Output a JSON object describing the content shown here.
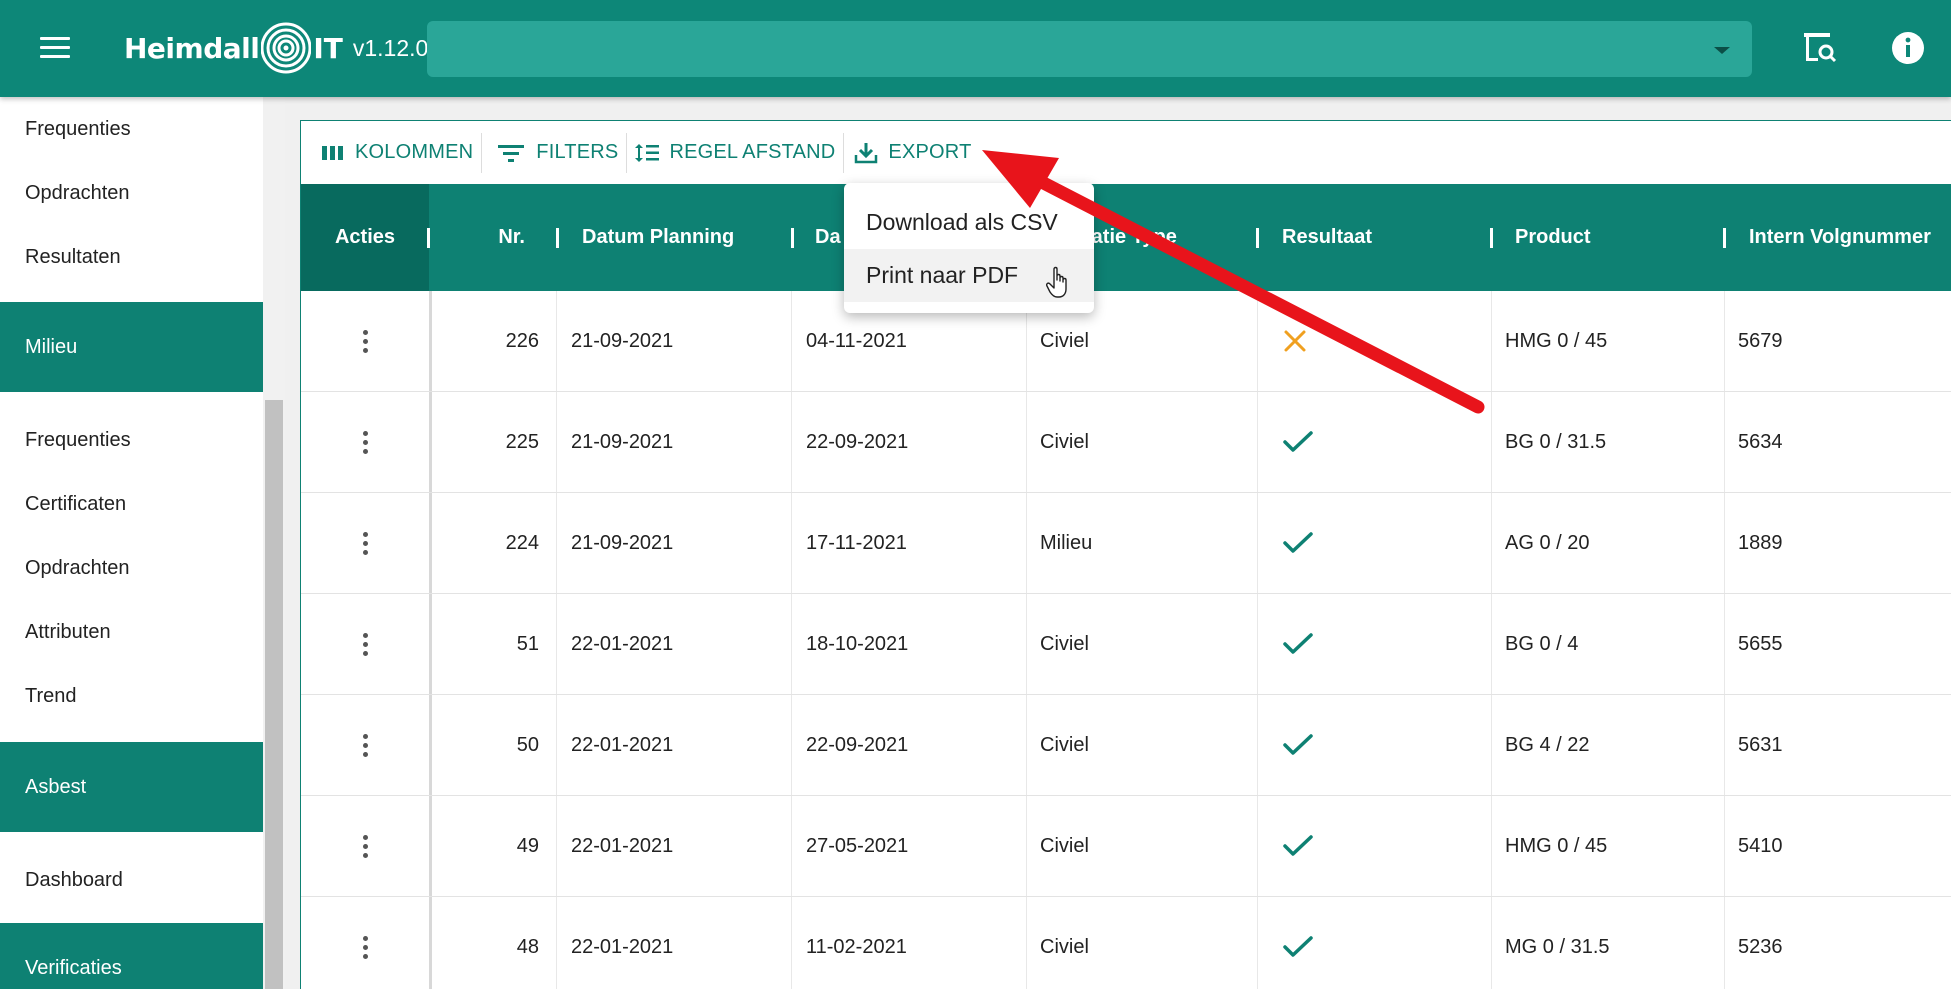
{
  "app": {
    "brand": "Heimdall",
    "brand_suffix": "IT",
    "version": "v1.12.0",
    "top_select_value": "",
    "icons": {
      "menu": "hamburger-icon",
      "search": "search-history-icon",
      "info": "info-icon"
    }
  },
  "sidebar": {
    "items": [
      {
        "label": "Frequenties",
        "type": "item"
      },
      {
        "label": "Opdrachten",
        "type": "item"
      },
      {
        "label": "Resultaten",
        "type": "item"
      },
      {
        "label": "Milieu",
        "type": "section"
      },
      {
        "label": "Frequenties",
        "type": "item"
      },
      {
        "label": "Certificaten",
        "type": "item"
      },
      {
        "label": "Opdrachten",
        "type": "item"
      },
      {
        "label": "Attributen",
        "type": "item"
      },
      {
        "label": "Trend",
        "type": "item"
      },
      {
        "label": "Asbest",
        "type": "section"
      },
      {
        "label": "Dashboard",
        "type": "item"
      },
      {
        "label": "Verificaties",
        "type": "section"
      }
    ]
  },
  "toolbar": {
    "kolommen": "KOLOMMEN",
    "filters": "FILTERS",
    "regel_afstand": "REGEL AFSTAND",
    "export": "EXPORT"
  },
  "export_menu": {
    "items": [
      "Download als CSV",
      "Print naar PDF"
    ]
  },
  "table": {
    "columns": [
      "Acties",
      "Nr.",
      "Datum Planning",
      "Da",
      "icatie Type",
      "Resultaat",
      "Product",
      "Intern Volgnummer"
    ],
    "rows": [
      {
        "nr": "226",
        "datum_planning": "21-09-2021",
        "datum": "04-11-2021",
        "type": "Civiel",
        "resultaat": "fail",
        "product": "HMG 0 / 45",
        "volgnummer": "5679"
      },
      {
        "nr": "225",
        "datum_planning": "21-09-2021",
        "datum": "22-09-2021",
        "type": "Civiel",
        "resultaat": "pass",
        "product": "BG 0 / 31.5",
        "volgnummer": "5634"
      },
      {
        "nr": "224",
        "datum_planning": "21-09-2021",
        "datum": "17-11-2021",
        "type": "Milieu",
        "resultaat": "pass",
        "product": "AG 0 / 20",
        "volgnummer": "1889"
      },
      {
        "nr": "51",
        "datum_planning": "22-01-2021",
        "datum": "18-10-2021",
        "type": "Civiel",
        "resultaat": "pass",
        "product": "BG 0 / 4",
        "volgnummer": "5655"
      },
      {
        "nr": "50",
        "datum_planning": "22-01-2021",
        "datum": "22-09-2021",
        "type": "Civiel",
        "resultaat": "pass",
        "product": "BG 4 / 22",
        "volgnummer": "5631"
      },
      {
        "nr": "49",
        "datum_planning": "22-01-2021",
        "datum": "27-05-2021",
        "type": "Civiel",
        "resultaat": "pass",
        "product": "HMG 0 / 45",
        "volgnummer": "5410"
      },
      {
        "nr": "48",
        "datum_planning": "22-01-2021",
        "datum": "11-02-2021",
        "type": "Civiel",
        "resultaat": "pass",
        "product": "MG 0 / 31.5",
        "volgnummer": "5236"
      }
    ]
  },
  "colors": {
    "header_teal": "#0d8778",
    "select_teal": "#2aa698",
    "section_teal": "#0e8173",
    "check_green": "#0e8173",
    "cross_orange": "#f0a020",
    "annotation_red": "#e8141b"
  }
}
